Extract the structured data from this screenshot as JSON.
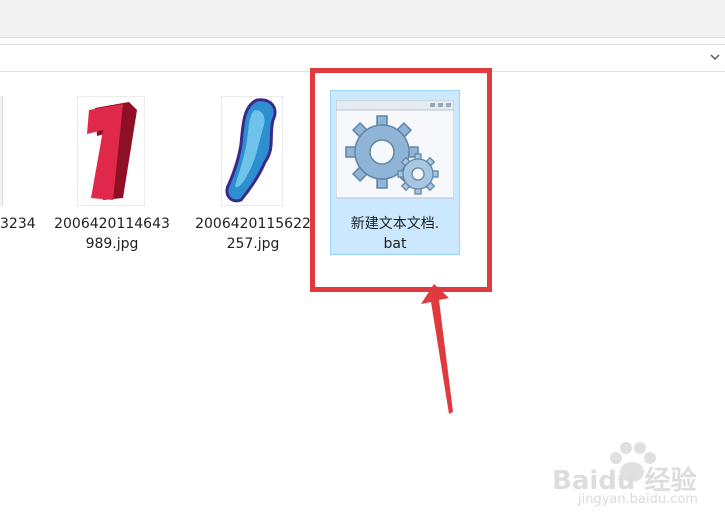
{
  "files": [
    {
      "name_line1": "3234",
      "name_line2": ""
    },
    {
      "name_line1": "2006420114643",
      "name_line2": "989.jpg"
    },
    {
      "name_line1": "2006420115622",
      "name_line2": "257.jpg"
    },
    {
      "name_line1": "新建文本文档.",
      "name_line2": "bat"
    }
  ],
  "watermark": {
    "brand": "Baidu 经验",
    "url": "jingyan.baidu.com"
  },
  "colors": {
    "highlight": "#e03a3e",
    "selection": "#cce8ff"
  }
}
